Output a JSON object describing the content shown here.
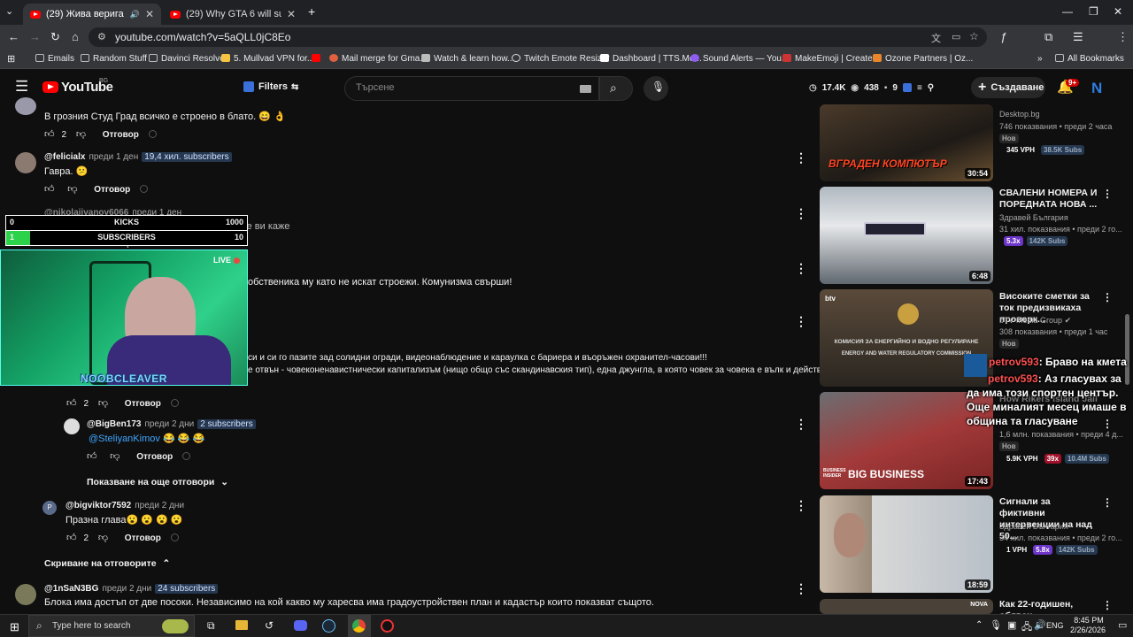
{
  "browser": {
    "tabs": [
      {
        "title": "(29) Жива верига пред бл...",
        "active": true
      },
      {
        "title": "(29) Why GTA 6 will suck. - YouT",
        "active": false
      }
    ],
    "url": "youtube.com/watch?v=5aQLL0jC8Eo",
    "bookmarks": [
      "Emails",
      "Random Stuff",
      "Davinci Resolve",
      "5. Mullvad VPN for...",
      "Mail merge for Gma...",
      "Watch & learn how...",
      "Twitch Emote Resizer",
      "Dashboard | TTS.Mo...",
      "Sound Alerts — You...",
      "MakeEmoji | Create...",
      "Ozone Partners | Oz..."
    ],
    "all_bookmarks": "All Bookmarks"
  },
  "youtube": {
    "logo": "YouTube",
    "region": "BG",
    "filters_label": "Filters",
    "search_placeholder": "Търсене",
    "stats": {
      "views": "17.4K",
      "watchers": "438",
      "count": "9"
    },
    "create_label": "Създаване",
    "notif_count": "9+",
    "avatar_letter": "N"
  },
  "comments": [
    {
      "text": "В грозния Студ Град всичко е строено в блато. 😄 👌",
      "likes": "2",
      "reply": "Отговор"
    },
    {
      "user": "@felicialx",
      "time": "преди 1 ден",
      "subs": "19,4 хил. subscribers",
      "text": "Гавра. 😕",
      "likes": "",
      "reply": "Отговор"
    },
    {
      "user": "@nikolaiivanov6066",
      "time": "преди 1 ден",
      "text": "Това е красива европейска столица Бойко ще ви каже",
      "reply": "Отговор"
    },
    {
      "text": "обственика му като не искат строежи. Комунизма свърши!"
    },
    {
      "text": "си и си го пазите зад солидни огради, видеонаблюдение и караулка с бариера и въоръжен охранител-часови!!!"
    },
    {
      "text": "е отвън - човеконенавистнически капитализъм (нищо общо със скандинавския тип), една джунгла, в която човек за човека е вълк и действа ..."
    },
    {
      "likes": "2",
      "reply": "Отговор"
    },
    {
      "user": "@BigBen173",
      "time": "преди 2 дни",
      "subs": "2 subscribers",
      "text_mention": "@SteliyanKimov",
      "text": "😂 😂 😂",
      "reply": "Отговор"
    },
    {
      "more_replies": "Показване на още отговори"
    },
    {
      "user": "@bigviktor7592",
      "time": "преди 2 дни",
      "text": "Празна глава😮 😮 😮 😮",
      "likes": "2",
      "reply": "Отговор",
      "avatar_letter": "P"
    },
    {
      "hide_replies": "Скриване на отговорите"
    },
    {
      "user": "@1nSaN3BG",
      "time": "преди 2 дни",
      "subs": "24 subscribers",
      "text": "Блока има достъп от две посоки. Независимо на кой какво му харесва има градоустройствен план и кадастър които показват същото."
    }
  ],
  "sidebar": [
    {
      "title": "",
      "channel": "Desktop.bg",
      "views": "746 показвания • преди 2 часа",
      "new": "Нов",
      "vph": "345 VPH",
      "subs": "38.5K Subs",
      "duration": "30:54",
      "thumb_text": "ВГРАДЕН КОМПЮТЪР"
    },
    {
      "title": "СВАЛЕНИ НОМЕРА И ПОРЕДНАТА НОВА ...",
      "channel": "Здравей България",
      "views": "31 хил. показвания • преди 2 го...",
      "mult": "5.3x",
      "subs": "142K Subs",
      "duration": "6:48"
    },
    {
      "title": "Високите сметки за ток предизвикаха проверк...",
      "channel": "bTV Media Group",
      "views": "308 показвания • преди 1 час",
      "new": "Нов",
      "thumb_text": "КОМИСИЯ ЗА ЕНЕРГИЙНО И ВОДНО РЕГУЛИРАНЕ",
      "thumb_text2": "ENERGY AND WATER REGULATORY COMMISSION"
    },
    {
      "title": "How Rikers Island Jail",
      "channel": "",
      "views": "1,6 млн. показвания • преди 4 д...",
      "new": "Нов",
      "vph": "5.9K VPH",
      "mult": "39x",
      "subs": "10.4M Subs",
      "duration": "17:43",
      "thumb_text": "BIG BUSINESS",
      "thumb_tag": "BUSINESS INSIDER"
    },
    {
      "title": "Сигнали за фиктивни интервенции на над 50...",
      "channel": "Здравей България",
      "views": "34 хил. показвания • преди 2 го...",
      "vph": "1 VPH",
      "mult": "5.8x",
      "subs": "142K Subs",
      "duration": "18:59"
    },
    {
      "title": "Как 22-годишен, обявен",
      "duration": "",
      "thumb_text": "NOVA"
    }
  ],
  "overlay": {
    "kicks": {
      "label": "KICKS",
      "current": "0",
      "goal": "1000"
    },
    "subscribers": {
      "label": "SUBSCRIBERS",
      "current": "1",
      "goal": "10",
      "progress": 0.1
    },
    "live": "LIVE",
    "streamer": "NOOBCLEAVER",
    "chat": [
      {
        "user": "petrov593",
        "msg": ": Браво на кмета"
      },
      {
        "user": "petrov593",
        "msg": ": Аз гласувах за да има този спортен център. Още миналият месец имаше в община та гласуване"
      }
    ]
  },
  "taskbar": {
    "search_placeholder": "Type here to search",
    "lang": "ENG",
    "time": "8:45 PM",
    "date": "2/26/2026"
  }
}
